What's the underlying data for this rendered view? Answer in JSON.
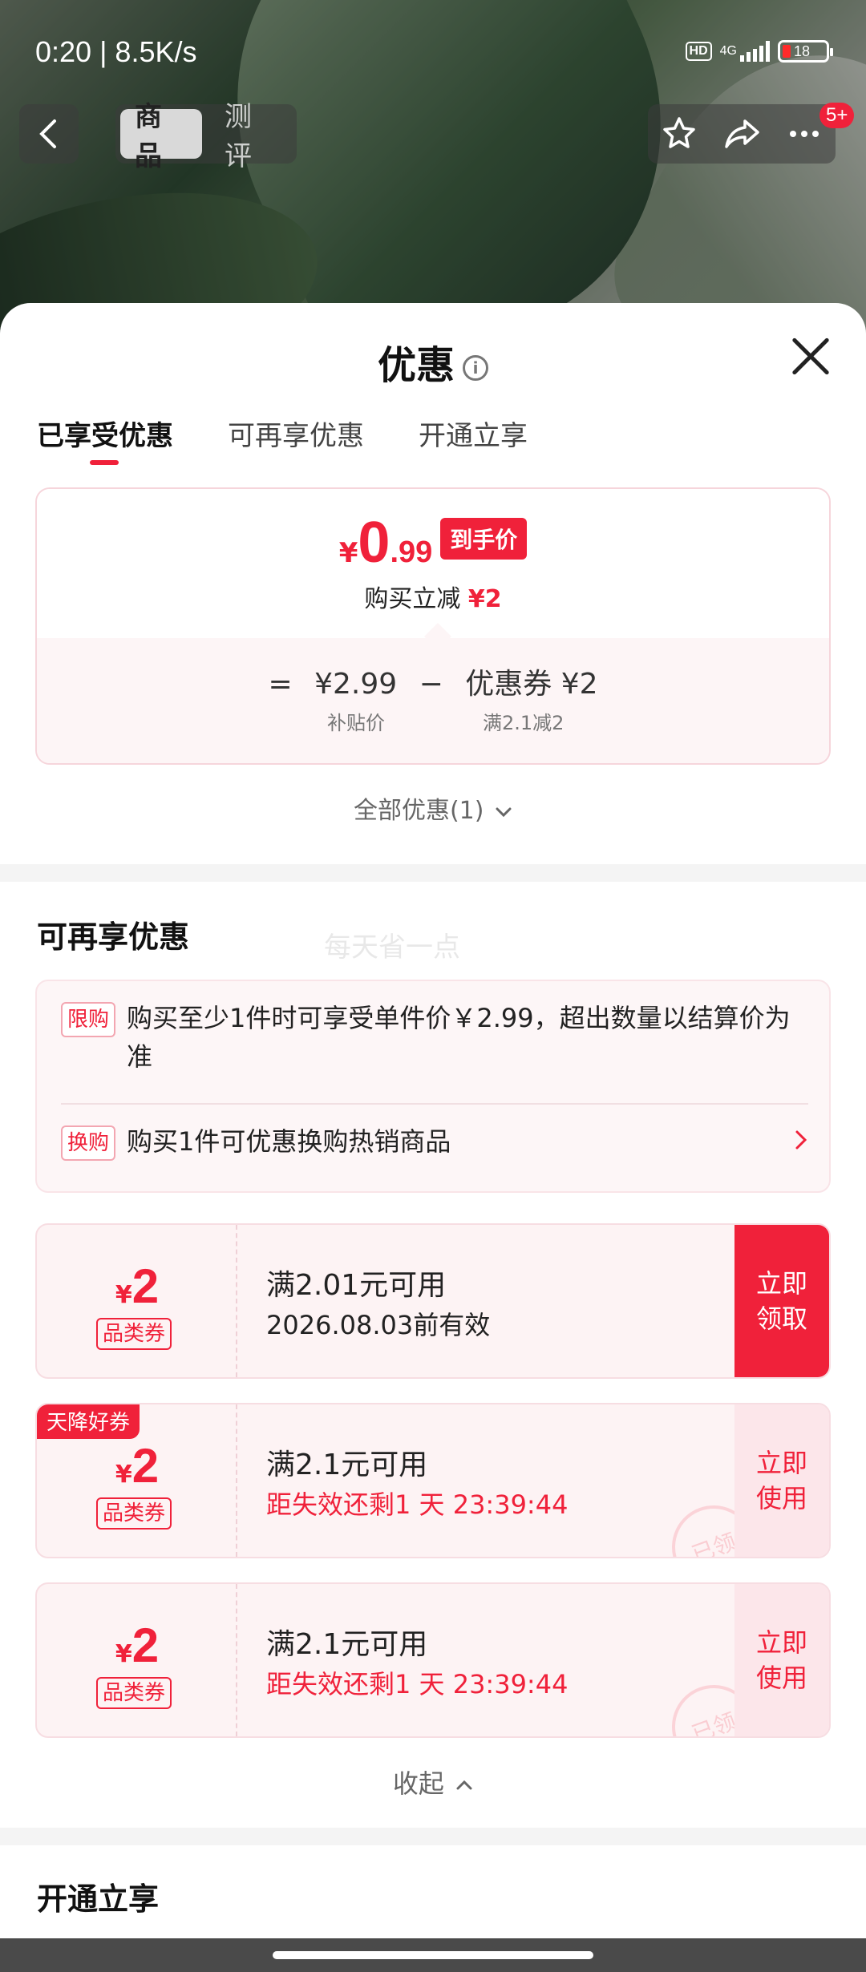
{
  "status_bar": {
    "time": "0:20 | 8.5K/s",
    "hd": "HD",
    "network": "4G",
    "battery": "18"
  },
  "nav": {
    "tabs": [
      {
        "label": "商品"
      },
      {
        "label": "测评"
      }
    ],
    "badge": "5+"
  },
  "sheet": {
    "title": "优惠",
    "info_icon": "i",
    "tabs": [
      {
        "label": "已享受优惠"
      },
      {
        "label": "可再享优惠"
      },
      {
        "label": "开通立享"
      }
    ],
    "price": {
      "currency": "¥",
      "integer": "0",
      "decimal": ".99",
      "tag": "到手价",
      "sub_text": "购买立减",
      "sub_amount": "¥2",
      "calc": {
        "equals": "=",
        "base": "¥2.99",
        "minus": "−",
        "coupon": "优惠券 ¥2"
      },
      "base_label": "补贴价",
      "coupon_label": "满2.1减2"
    },
    "all_offers": "全部优惠(1)",
    "more_section": {
      "title": "可再享优惠",
      "watermark": "每天省一点",
      "rules": [
        {
          "tag": "限购",
          "text": "购买至少1件时可享受单件价￥2.99，超出数量以结算价为准"
        },
        {
          "tag": "换购",
          "text": "购买1件可优惠换购热销商品"
        }
      ],
      "coupons": [
        {
          "currency": "¥",
          "amount": "2",
          "type": "品类券",
          "flag": "",
          "main": "满2.01元可用",
          "sub": "2026.08.03前有效",
          "button": "立即\n领取",
          "stamp": ""
        },
        {
          "currency": "¥",
          "amount": "2",
          "type": "品类券",
          "flag": "天降好券",
          "main": "满2.1元可用",
          "sub": "距失效还剩1 天 23:39:44",
          "button": "立即\n使用",
          "stamp": "已领"
        },
        {
          "currency": "¥",
          "amount": "2",
          "type": "品类券",
          "flag": "",
          "main": "满2.1元可用",
          "sub": "距失效还剩1 天 23:39:44",
          "button": "立即\n使用",
          "stamp": "已领"
        }
      ],
      "collapse": "收起"
    },
    "open_section": {
      "title": "开通立享"
    }
  },
  "colors": {
    "accent": "#f0213a",
    "soft_accent": "#fce6ea",
    "card_bg": "#fdf3f4"
  }
}
